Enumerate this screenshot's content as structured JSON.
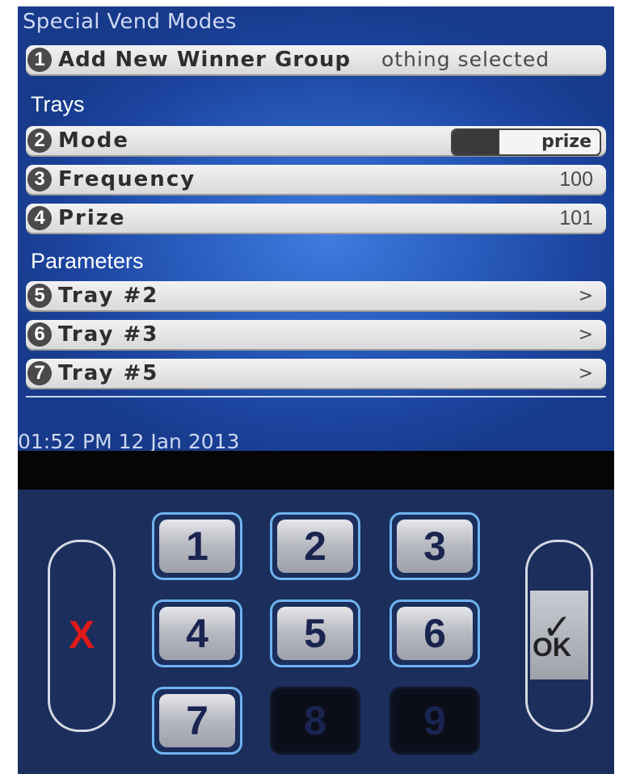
{
  "screen": {
    "title": "Special Vend Modes",
    "winner_row": {
      "number": "1",
      "label": "Add New Winner Group",
      "value": "Nothing selected",
      "overlap_value": "othing selected"
    },
    "trays_section": "Trays",
    "trays_rows": [
      {
        "number": "2",
        "label": "Mode",
        "value": "prize",
        "control": "toggle"
      },
      {
        "number": "3",
        "label": "Frequency",
        "value": "100"
      },
      {
        "number": "4",
        "label": "Prize",
        "value": "101"
      }
    ],
    "parameters_section": "Parameters",
    "parameter_rows": [
      {
        "number": "5",
        "label": "Tray #2",
        "chevron": ">"
      },
      {
        "number": "6",
        "label": "Tray #3",
        "chevron": ">"
      },
      {
        "number": "7",
        "label": "Tray #5",
        "chevron": ">"
      }
    ],
    "datetime": "01:52 PM 12 Jan 2013"
  },
  "keypad": {
    "cancel_label": "X",
    "ok_label": "OK",
    "ok_check": "✓",
    "keys": [
      {
        "label": "1",
        "enabled": true
      },
      {
        "label": "2",
        "enabled": true
      },
      {
        "label": "3",
        "enabled": true
      },
      {
        "label": "4",
        "enabled": true
      },
      {
        "label": "5",
        "enabled": true
      },
      {
        "label": "6",
        "enabled": true
      },
      {
        "label": "7",
        "enabled": true
      },
      {
        "label": "8",
        "enabled": false
      },
      {
        "label": "9",
        "enabled": false
      }
    ]
  },
  "colors": {
    "screen_background": "#2a5fc0",
    "row_background": "#e4e4e4",
    "keypad_background": "#1b2e5c",
    "key_border": "#6fb2f0",
    "cancel_mark": "#e01a1a"
  }
}
